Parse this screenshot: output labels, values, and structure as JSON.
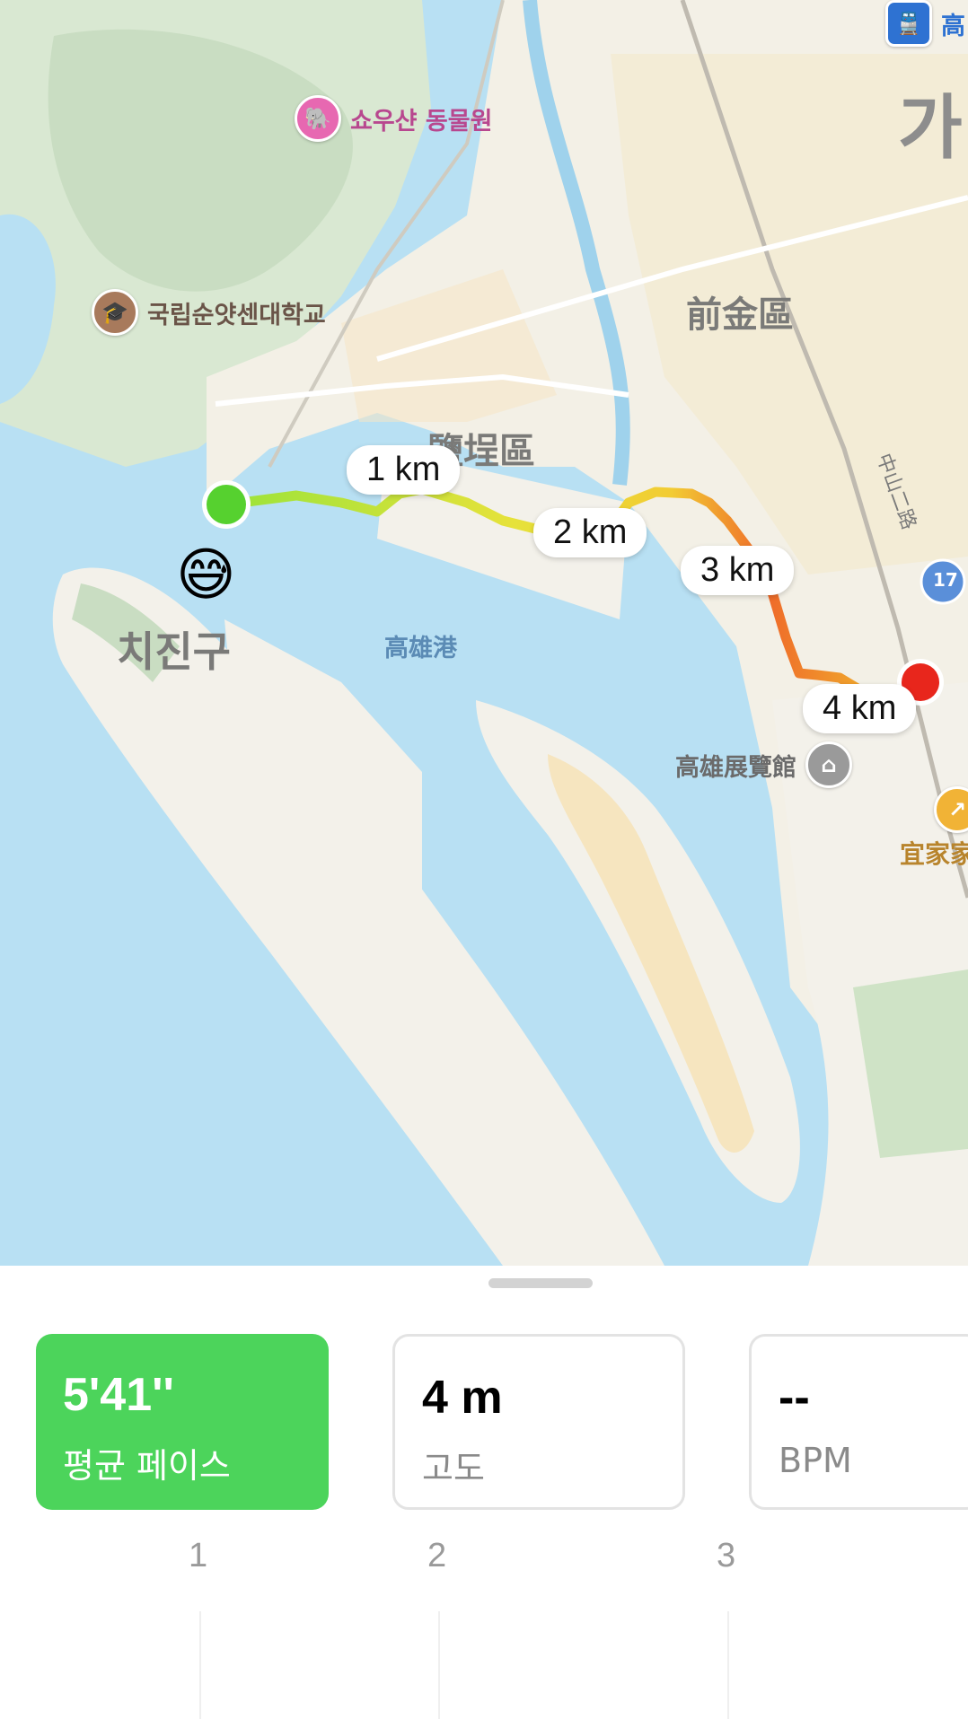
{
  "map": {
    "pois": {
      "zoo": "쇼우샨 동물원",
      "university": "국립순얏센대학교",
      "exhibition": "高雄展覽館",
      "store": "宜家家",
      "station": "高"
    },
    "districts": {
      "qianjin": "前金區",
      "yancheng": "鹽埕區",
      "cijin": "치진구",
      "port": "高雄港",
      "partial": "가",
      "road": "中山二路",
      "route_shield": "17"
    },
    "km_markers": [
      "1 km",
      "2 km",
      "3 km",
      "4 km"
    ],
    "emoji": "😅",
    "colors": {
      "water": "#b8e0f3",
      "land": "#f3f1ea",
      "route_start": "#56d12f",
      "route_end": "#e8261c"
    }
  },
  "stats": {
    "pace": {
      "value": "5'41''",
      "label": "평균 페이스"
    },
    "altitude": {
      "value": "4 m",
      "label": "고도"
    },
    "heart": {
      "value": "--",
      "label": "BPM"
    }
  },
  "axis_ticks": [
    "1",
    "2",
    "3"
  ]
}
